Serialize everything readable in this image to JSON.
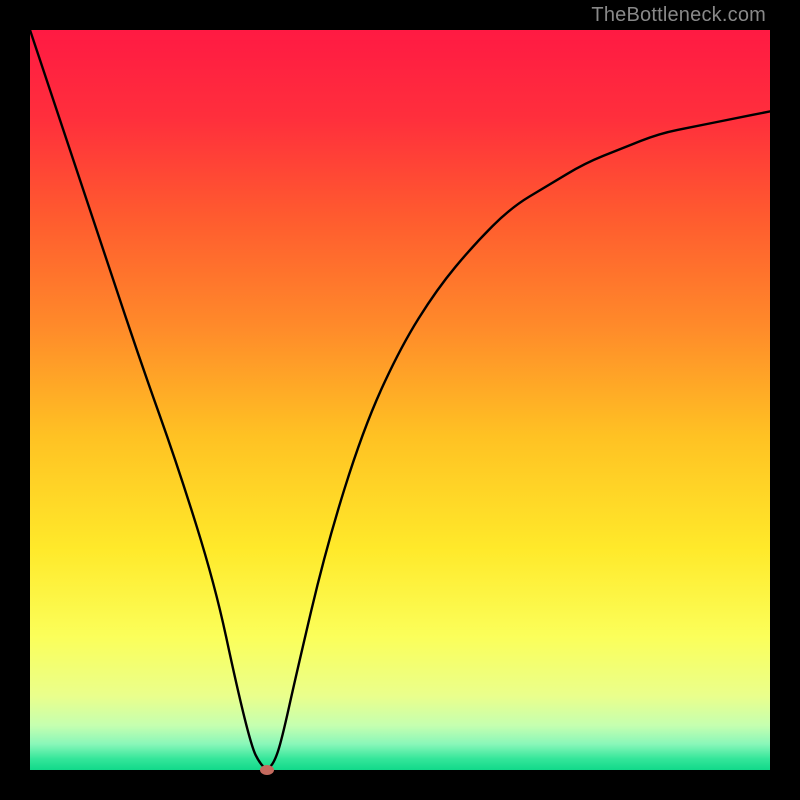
{
  "watermark": "TheBottleneck.com",
  "colors": {
    "frame": "#000000",
    "gradient_stops": [
      {
        "offset": 0.0,
        "color": "#ff1a43"
      },
      {
        "offset": 0.12,
        "color": "#ff2f3c"
      },
      {
        "offset": 0.25,
        "color": "#ff5a2f"
      },
      {
        "offset": 0.4,
        "color": "#ff8a2a"
      },
      {
        "offset": 0.55,
        "color": "#ffc223"
      },
      {
        "offset": 0.7,
        "color": "#ffe92a"
      },
      {
        "offset": 0.82,
        "color": "#fbff5a"
      },
      {
        "offset": 0.9,
        "color": "#eaff8c"
      },
      {
        "offset": 0.94,
        "color": "#c5ffb0"
      },
      {
        "offset": 0.965,
        "color": "#89f7b9"
      },
      {
        "offset": 0.985,
        "color": "#34e69a"
      },
      {
        "offset": 1.0,
        "color": "#11d98a"
      }
    ],
    "curve": "#000000",
    "marker": "#c46a5e"
  },
  "chart_data": {
    "type": "line",
    "title": "",
    "xlabel": "",
    "ylabel": "",
    "xlim": [
      0,
      100
    ],
    "ylim": [
      0,
      100
    ],
    "series": [
      {
        "name": "bottleneck-curve",
        "x": [
          0,
          5,
          10,
          15,
          20,
          25,
          28,
          30,
          31,
          32,
          33,
          34,
          36,
          40,
          45,
          50,
          55,
          60,
          65,
          70,
          75,
          80,
          85,
          90,
          95,
          100
        ],
        "y": [
          100,
          85,
          70,
          55,
          41,
          25,
          11,
          3,
          1,
          0,
          1,
          4,
          13,
          30,
          46,
          57,
          65,
          71,
          76,
          79,
          82,
          84,
          86,
          87,
          88,
          89
        ]
      }
    ],
    "marker": {
      "x": 32,
      "y": 0
    },
    "description": "V-shaped curve plotted over a vertical red-to-green gradient. The curve minimum (bottleneck optimum) is near x≈32 at y≈0; the left branch descends steeply from y=100 at x=0, the right branch rises with decreasing slope toward y≈89 at x=100."
  }
}
